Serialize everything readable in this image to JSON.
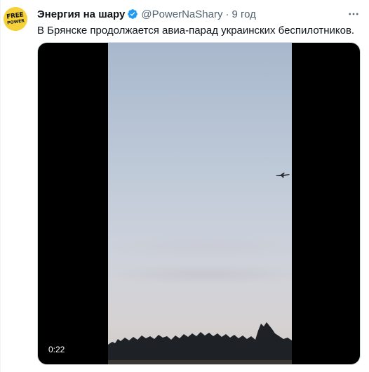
{
  "tweet": {
    "avatar": {
      "line1": "FREE",
      "line2": "POWER",
      "color": "#f5d13a"
    },
    "author_name": "Энергия на шару",
    "verified": true,
    "verified_color": "#1d9bf0",
    "handle": "@PowerNaShary",
    "separator": "·",
    "time": "9 год",
    "text": "В Брянске продолжается авиа-парад украинских беспилотников.",
    "more_icon": "ellipsis-icon"
  },
  "video": {
    "duration": "0:22"
  }
}
